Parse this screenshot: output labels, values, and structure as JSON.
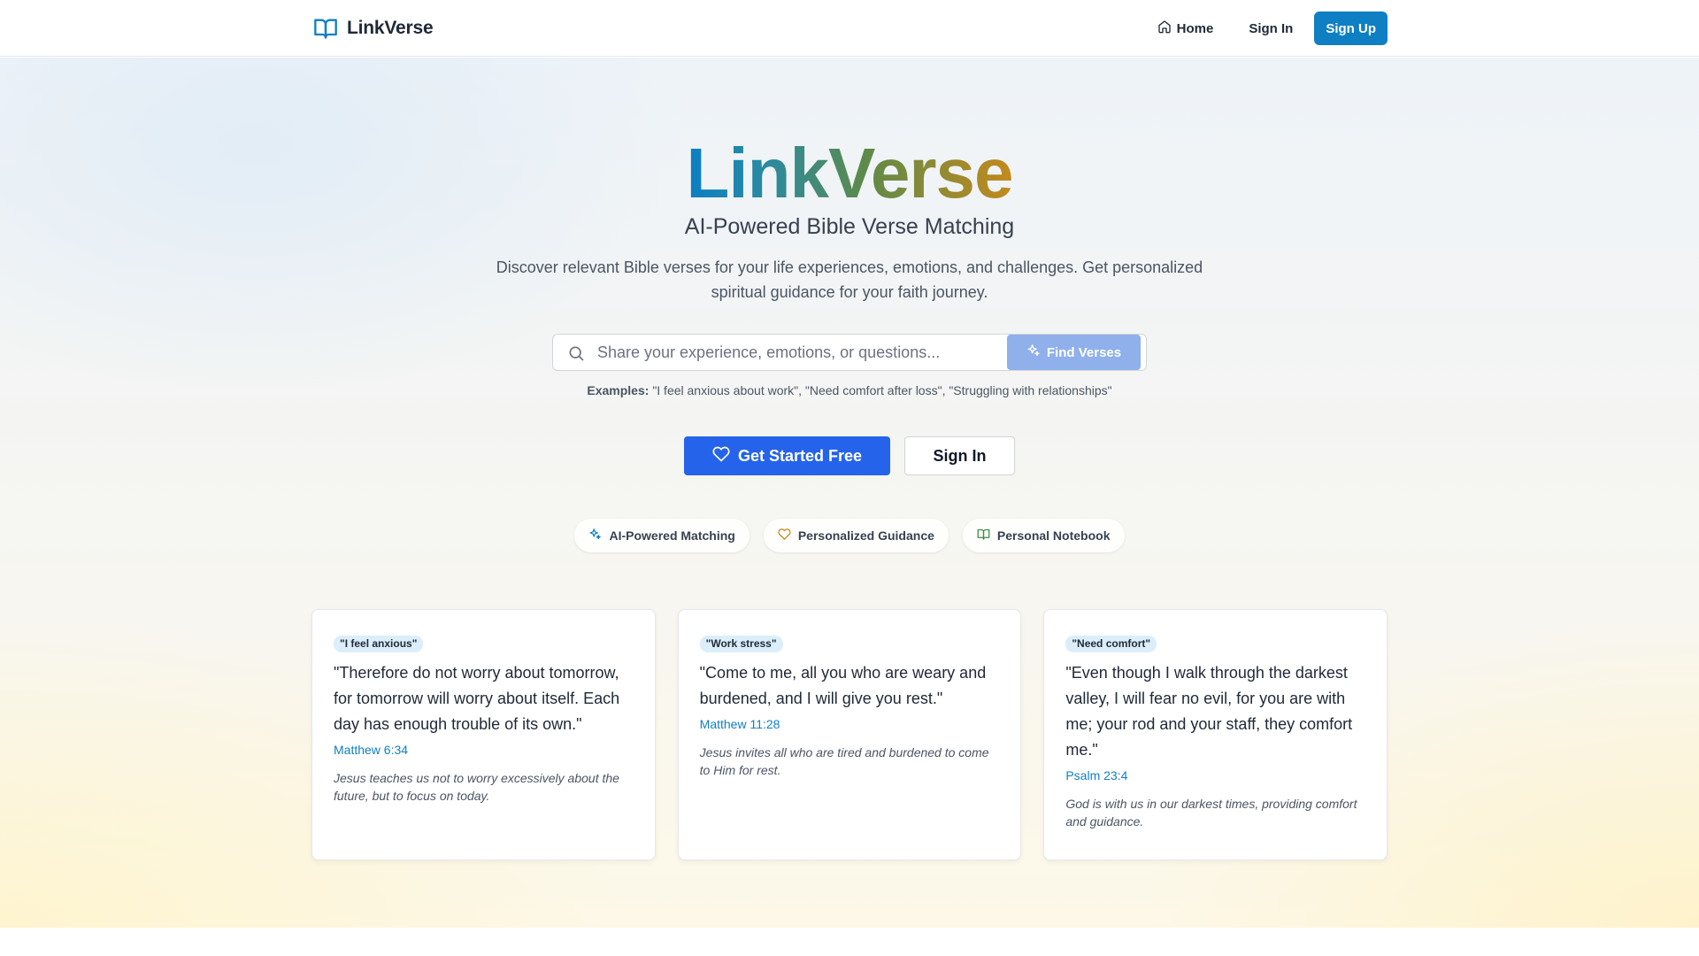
{
  "nav": {
    "brand": "LinkVerse",
    "brand_icon": "open-book-icon",
    "home_label": "Home",
    "signin_label": "Sign In",
    "signup_label": "Sign Up"
  },
  "hero": {
    "title": "LinkVerse",
    "subtitle": "AI-Powered Bible Verse Matching",
    "description": "Discover relevant Bible verses for your life experiences, emotions, and challenges. Get personalized spiritual guidance for your faith journey."
  },
  "search": {
    "placeholder": "Share your experience, emotions, or questions...",
    "value": "",
    "button_label": "Find Verses"
  },
  "examples": {
    "label": "Examples:",
    "text": "\"I feel anxious about work\", \"Need comfort after loss\", \"Struggling with relationships\""
  },
  "cta": {
    "primary_label": "Get Started Free",
    "secondary_label": "Sign In"
  },
  "features": [
    {
      "label": "AI-Powered Matching",
      "icon": "sparkles-icon"
    },
    {
      "label": "Personalized Guidance",
      "icon": "heart-icon"
    },
    {
      "label": "Personal Notebook",
      "icon": "book-icon"
    }
  ],
  "cards": [
    {
      "tag": "\"I feel anxious\"",
      "verse": "\"Therefore do not worry about tomorrow, for tomorrow will worry about itself. Each day has enough trouble of its own.\"",
      "reference": "Matthew 6:34",
      "note": "Jesus teaches us not to worry excessively about the future, but to focus on today."
    },
    {
      "tag": "\"Work stress\"",
      "verse": "\"Come to me, all you who are weary and burdened, and I will give you rest.\"",
      "reference": "Matthew 11:28",
      "note": "Jesus invites all who are tired and burdened to come to Him for rest."
    },
    {
      "tag": "\"Need comfort\"",
      "verse": "\"Even though I walk through the darkest valley, I will fear no evil, for you are with me; your rod and your staff, they comfort me.\"",
      "reference": "Psalm 23:4",
      "note": "God is with us in our darkest times, providing comfort and guidance."
    }
  ],
  "colors": {
    "primary": "#2563eb",
    "brand_blue": "#0f7fc4",
    "find_button": "#8fb0ea",
    "tag_bg": "#dbeefa",
    "gradient_start": "#0b7fc4",
    "gradient_end": "#c48a1c"
  }
}
